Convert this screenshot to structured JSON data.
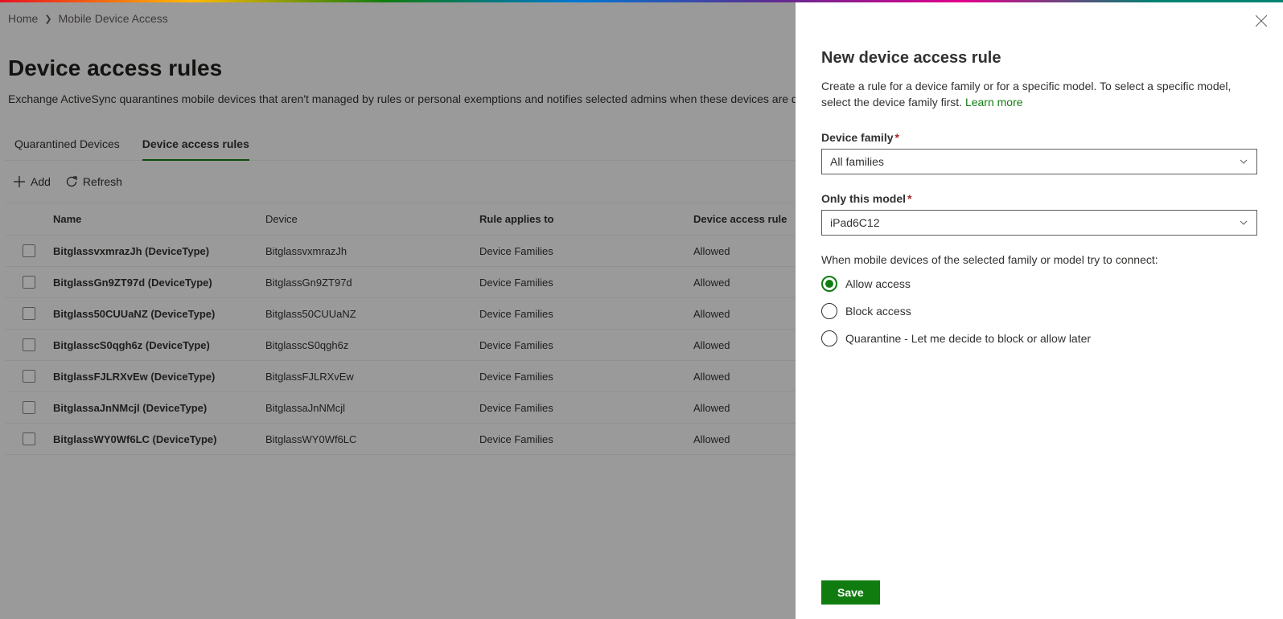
{
  "breadcrumb": {
    "home": "Home",
    "current": "Mobile Device Access"
  },
  "page": {
    "title": "Device access rules",
    "description": "Exchange ActiveSync quarantines mobile devices that aren't managed by rules or personal exemptions and notifies selected admins when these devices are quarantined."
  },
  "tabs": {
    "quarantined": "Quarantined Devices",
    "rules": "Device access rules"
  },
  "toolbar": {
    "add": "Add",
    "refresh": "Refresh"
  },
  "table": {
    "headers": {
      "name": "Name",
      "device": "Device",
      "rule_applies": "Rule applies to",
      "access_rule": "Device access rule"
    },
    "rows": [
      {
        "name": "BitglassvxmrazJh (DeviceType)",
        "device": "BitglassvxmrazJh",
        "rule": "Device Families",
        "access": "Allowed"
      },
      {
        "name": "BitglassGn9ZT97d (DeviceType)",
        "device": "BitglassGn9ZT97d",
        "rule": "Device Families",
        "access": "Allowed"
      },
      {
        "name": "Bitglass50CUUaNZ (DeviceType)",
        "device": "Bitglass50CUUaNZ",
        "rule": "Device Families",
        "access": "Allowed"
      },
      {
        "name": "BitglasscS0qgh6z (DeviceType)",
        "device": "BitglasscS0qgh6z",
        "rule": "Device Families",
        "access": "Allowed"
      },
      {
        "name": "BitglassFJLRXvEw (DeviceType)",
        "device": "BitglassFJLRXvEw",
        "rule": "Device Families",
        "access": "Allowed"
      },
      {
        "name": "BitglassaJnNMcjl (DeviceType)",
        "device": "BitglassaJnNMcjl",
        "rule": "Device Families",
        "access": "Allowed"
      },
      {
        "name": "BitglassWY0Wf6LC (DeviceType)",
        "device": "BitglassWY0Wf6LC",
        "rule": "Device Families",
        "access": "Allowed"
      }
    ]
  },
  "panel": {
    "title": "New device access rule",
    "description_pre": "Create a rule for a device family or for a specific model. To select a specific model, select the device family first. ",
    "learn_more": "Learn more",
    "device_family_label": "Device family",
    "device_family_value": "All families",
    "model_label": "Only this model",
    "model_value": "iPad6C12",
    "connect_label": "When mobile devices of the selected family or model try to connect:",
    "options": {
      "allow": "Allow access",
      "block": "Block access",
      "quarantine": "Quarantine - Let me decide to block or allow later"
    },
    "save": "Save"
  }
}
